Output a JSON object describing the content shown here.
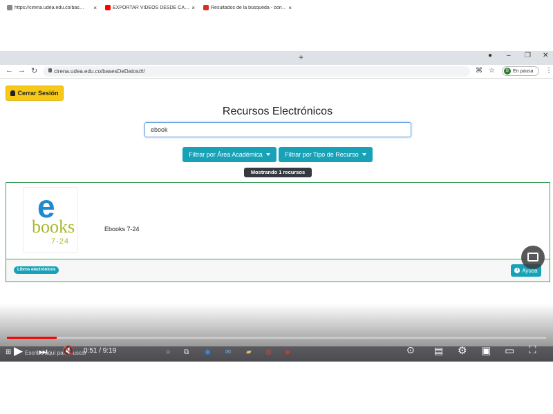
{
  "browser": {
    "tabs": [
      {
        "title": "https://cirena.udea.edu.co/bas…",
        "favicon_color": "#888888",
        "active": true
      },
      {
        "title": "EXPORTAR VIDEOS DESDE CA…",
        "favicon_color": "#ff0000",
        "active": false
      },
      {
        "title": "Resultados de la búsqueda - oon…",
        "favicon_color": "#d93025",
        "active": false
      }
    ],
    "tab_close": "×",
    "new_tab": "+",
    "address": "cirena.udea.edu.co/basesDeDatos/#/",
    "profile_label": "En pausa",
    "profile_initial": "B"
  },
  "page": {
    "logout_label": "Cerrar Sesión",
    "title": "Recursos Electrónicos",
    "search_value": "ebook",
    "filter_area_label": "Filtrar por Área Académica",
    "filter_type_label": "Filtrar por Tipo de Recurso",
    "showing_label": "Mostrando 1 recursos",
    "resource": {
      "logo_e": "e",
      "logo_books": "books",
      "logo_number": "7-24",
      "name": "Ebooks 7-24",
      "badge": "Libros electrónicos"
    },
    "help_label": "Ayuda",
    "help_info_glyph": "i"
  },
  "player": {
    "time": "0:51 / 9:19",
    "progress_fraction": 0.0923,
    "progress_color": "#ff0000"
  },
  "taskbar": {
    "search_placeholder": "Escribe aquí para buscar"
  },
  "colors": {
    "accent_teal": "#17a2b8",
    "logout_yellow": "#f7c815",
    "card_border": "#3aa05a"
  }
}
